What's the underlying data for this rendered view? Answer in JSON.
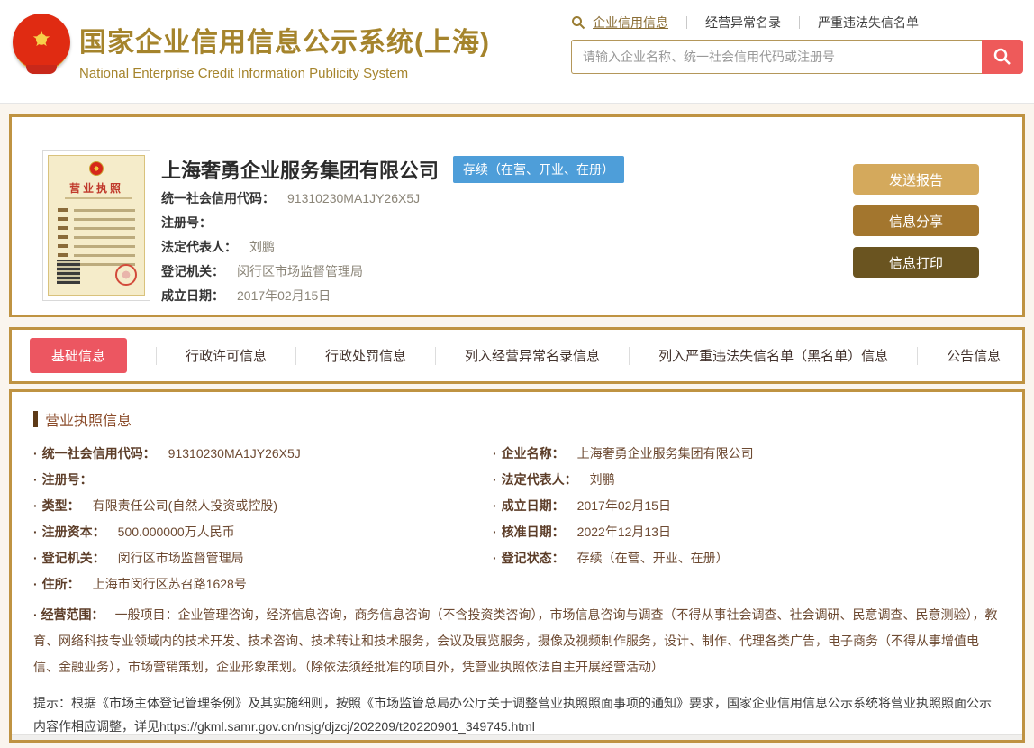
{
  "header": {
    "title": "国家企业信用信息公示系统(上海)",
    "subtitle": "National Enterprise Credit Information Publicity System",
    "nav": [
      {
        "label": "企业信用信息",
        "active": true
      },
      {
        "label": "经营异常名录",
        "active": false
      },
      {
        "label": "严重违法失信名单",
        "active": false
      }
    ],
    "search": {
      "placeholder": "请输入企业名称、统一社会信用代码或注册号",
      "value": "",
      "icon": "search-icon"
    }
  },
  "company_card": {
    "license_title": "营业执照",
    "name": "上海奢勇企业服务集团有限公司",
    "status_badge": "存续（在营、开业、在册）",
    "fields": [
      {
        "label": "统一社会信用代码：",
        "value": "91310230MA1JY26X5J"
      },
      {
        "label": "注册号：",
        "value": ""
      },
      {
        "label": "法定代表人：",
        "value": "刘鹏"
      },
      {
        "label": "登记机关：",
        "value": "闵行区市场监督管理局"
      },
      {
        "label": "成立日期：",
        "value": "2017年02月15日"
      }
    ],
    "buttons": [
      {
        "label": "发送报告",
        "color": "#d4a95c"
      },
      {
        "label": "信息分享",
        "color": "#a3762e"
      },
      {
        "label": "信息打印",
        "color": "#6a5420"
      }
    ]
  },
  "tabs": [
    {
      "label": "基础信息",
      "active": true
    },
    {
      "label": "行政许可信息",
      "active": false
    },
    {
      "label": "行政处罚信息",
      "active": false
    },
    {
      "label": "列入经营异常名录信息",
      "active": false
    },
    {
      "label": "列入严重违法失信名单（黑名单）信息",
      "active": false
    },
    {
      "label": "公告信息",
      "active": false
    }
  ],
  "license_section": {
    "title": "营业执照信息",
    "left_fields": [
      {
        "label": "统一社会信用代码：",
        "value": "91310230MA1JY26X5J"
      },
      {
        "label": "注册号：",
        "value": ""
      },
      {
        "label": "类型：",
        "value": "有限责任公司(自然人投资或控股)"
      },
      {
        "label": "注册资本：",
        "value": "500.000000万人民币"
      },
      {
        "label": "登记机关：",
        "value": "闵行区市场监督管理局"
      },
      {
        "label": "住所：",
        "value": "上海市闵行区苏召路1628号"
      }
    ],
    "right_fields": [
      {
        "label": "企业名称：",
        "value": "上海奢勇企业服务集团有限公司"
      },
      {
        "label": "法定代表人：",
        "value": "刘鹏"
      },
      {
        "label": "成立日期：",
        "value": "2017年02月15日"
      },
      {
        "label": "核准日期：",
        "value": "2022年12月13日"
      },
      {
        "label": "登记状态：",
        "value": "存续（在营、开业、在册）"
      }
    ],
    "scope": {
      "label": "经营范围：",
      "value": "一般项目：企业管理咨询，经济信息咨询，商务信息咨询（不含投资类咨询），市场信息咨询与调查（不得从事社会调查、社会调研、民意调查、民意测验），教育、网络科技专业领域内的技术开发、技术咨询、技术转让和技术服务，会议及展览服务，摄像及视频制作服务，设计、制作、代理各类广告，电子商务（不得从事增值电信、金融业务），市场营销策划，企业形象策划。（除依法须经批准的项目外，凭营业执照依法自主开展经营活动）"
    },
    "notice": "提示：根据《市场主体登记管理条例》及其实施细则，按照《市场监管总局办公厅关于调整营业执照照面事项的通知》要求，国家企业信用信息公示系统将营业执照照面公示内容作相应调整，详见https://gkml.samr.gov.cn/nsjg/djzcj/202209/t20220901_349745.html"
  },
  "colors": {
    "gold_title": "#a5842c",
    "gold_border": "#bf9342",
    "page_bg": "#faf5ee",
    "accent_red": "#ee5a5a",
    "tab_active_red": "#ec5661",
    "badge_blue": "#4e9ed9",
    "field_brown": "#6d4a32"
  }
}
